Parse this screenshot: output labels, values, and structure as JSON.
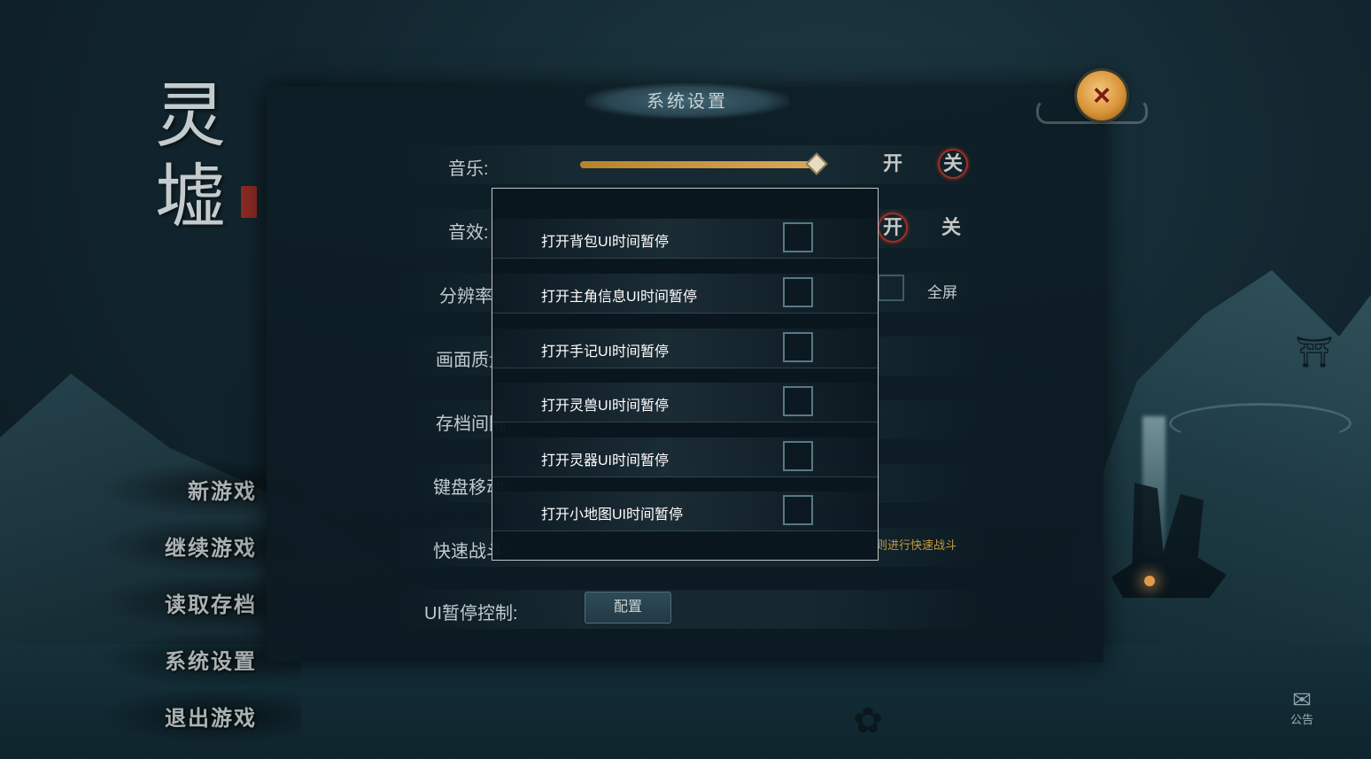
{
  "logo": {
    "chars": [
      "灵",
      "墟"
    ]
  },
  "main_menu": {
    "items": [
      {
        "label": "新游戏"
      },
      {
        "label": "继续游戏"
      },
      {
        "label": "读取存档"
      },
      {
        "label": "系统设置"
      },
      {
        "label": "退出游戏"
      }
    ]
  },
  "settings": {
    "title": "系统设置",
    "close_icon": "×",
    "music": {
      "label": "音乐:",
      "level": 0.94,
      "on": "开",
      "off": "关",
      "active": "off"
    },
    "sfx": {
      "label": "音效:",
      "on": "开",
      "off": "关",
      "active": "on"
    },
    "resolution": {
      "label": "分辨率:",
      "fullscreen_label": "全屏"
    },
    "quality": {
      "label": "画面质量:"
    },
    "save_interval": {
      "label": "存档间隔:"
    },
    "keyboard_move": {
      "label": "键盘移动:"
    },
    "quick_fight": {
      "label": "快速战斗:",
      "note": "则进行快速战斗"
    },
    "ui_pause": {
      "label": "UI暂停控制:",
      "button": "配置"
    }
  },
  "popup": {
    "options": [
      {
        "label": "打开背包UI时间暂停",
        "checked": false
      },
      {
        "label": "打开主角信息UI时间暂停",
        "checked": false
      },
      {
        "label": "打开手记UI时间暂停",
        "checked": false
      },
      {
        "label": "打开灵兽UI时间暂停",
        "checked": false
      },
      {
        "label": "打开灵器UI时间暂停",
        "checked": false
      },
      {
        "label": "打开小地图UI时间暂停",
        "checked": false
      }
    ]
  },
  "announcement": {
    "label": "公告"
  }
}
